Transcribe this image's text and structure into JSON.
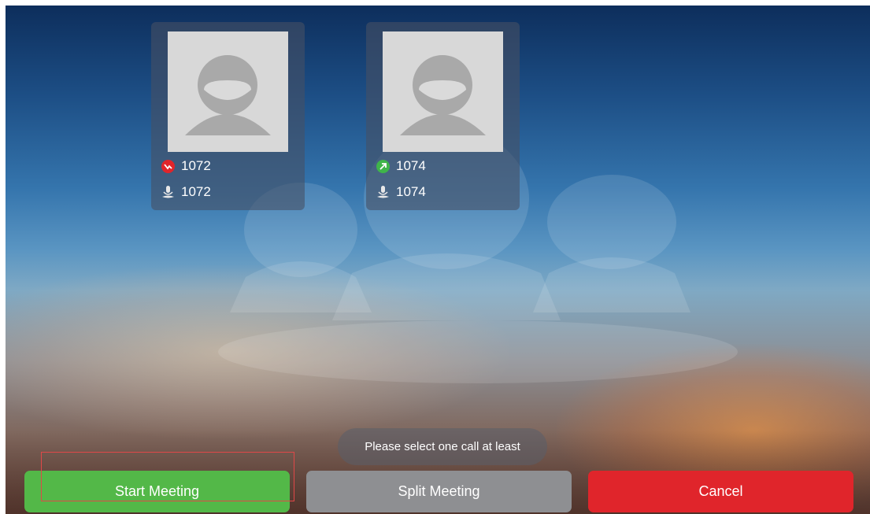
{
  "participants": [
    {
      "caller_number": "1072",
      "caller_status": "held",
      "caller_status_color": "#e0252b",
      "mic_number": "1072"
    },
    {
      "caller_number": "1074",
      "caller_status": "outgoing",
      "caller_status_color": "#3fb54a",
      "mic_number": "1074"
    }
  ],
  "toast": {
    "message": "Please select one call at least"
  },
  "buttons": {
    "start_label": "Start Meeting",
    "split_label": "Split Meeting",
    "cancel_label": "Cancel"
  },
  "colors": {
    "start": "#53b848",
    "split": "#8e8f92",
    "cancel": "#e0252b"
  },
  "icons": {
    "avatar": "user-placeholder-icon",
    "held": "held-call-icon",
    "outgoing": "outgoing-call-icon",
    "mic": "microphone-icon"
  }
}
